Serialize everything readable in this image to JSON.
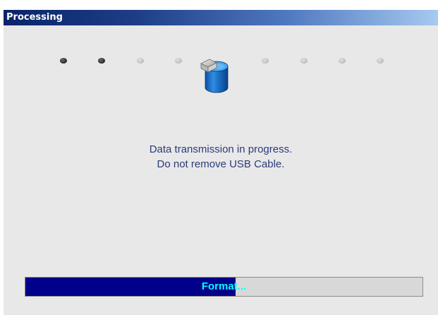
{
  "window": {
    "title": "Processing"
  },
  "animation": {
    "icon": "database-icon",
    "dots": [
      "dark",
      "dark",
      "light",
      "light",
      "light",
      "light",
      "light",
      "light"
    ]
  },
  "message": {
    "line1": "Data transmission in progress.",
    "line2": "Do not remove USB Cable."
  },
  "progress": {
    "label": "Format...",
    "fraction": 0.53
  },
  "colors": {
    "title_start": "#0a246a",
    "title_end": "#a6caf0",
    "background": "#e8e8e8",
    "message_text": "#2b3b7a",
    "progress_fill": "#00008b",
    "progress_track": "#d8d8d8",
    "progress_text": "#00ffff"
  }
}
